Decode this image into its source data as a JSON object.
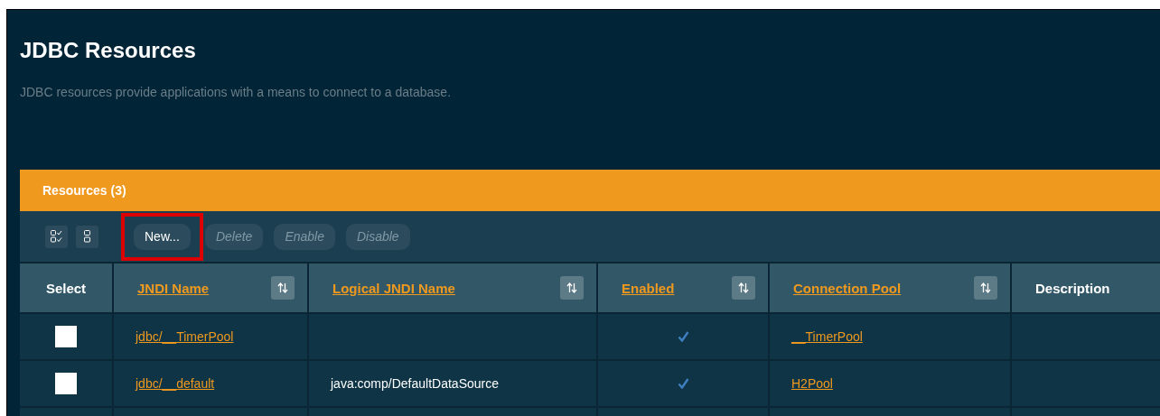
{
  "page": {
    "title": "JDBC Resources",
    "description": "JDBC resources provide applications with a means to connect to a database."
  },
  "table": {
    "title": "Resources (3)",
    "toolbar": [
      {
        "label": "New...",
        "disabled": false,
        "highlighted": true
      },
      {
        "label": "Delete",
        "disabled": true,
        "highlighted": false
      },
      {
        "label": "Enable",
        "disabled": true,
        "highlighted": false
      },
      {
        "label": "Disable",
        "disabled": true,
        "highlighted": false
      }
    ],
    "columns": [
      {
        "label": "Select",
        "sortable": false
      },
      {
        "label": "JNDI Name",
        "sortable": true
      },
      {
        "label": "Logical JNDI Name",
        "sortable": true
      },
      {
        "label": "Enabled",
        "sortable": true
      },
      {
        "label": "Connection Pool",
        "sortable": true
      },
      {
        "label": "Description",
        "sortable": false
      }
    ],
    "rows": [
      {
        "checked": false,
        "jndi_name": "jdbc/__TimerPool",
        "logical_jndi_name": "",
        "enabled": true,
        "connection_pool": "__TimerPool"
      },
      {
        "checked": false,
        "jndi_name": "jdbc/__default",
        "logical_jndi_name": "java:comp/DefaultDataSource",
        "enabled": true,
        "connection_pool": "H2Pool"
      }
    ]
  }
}
